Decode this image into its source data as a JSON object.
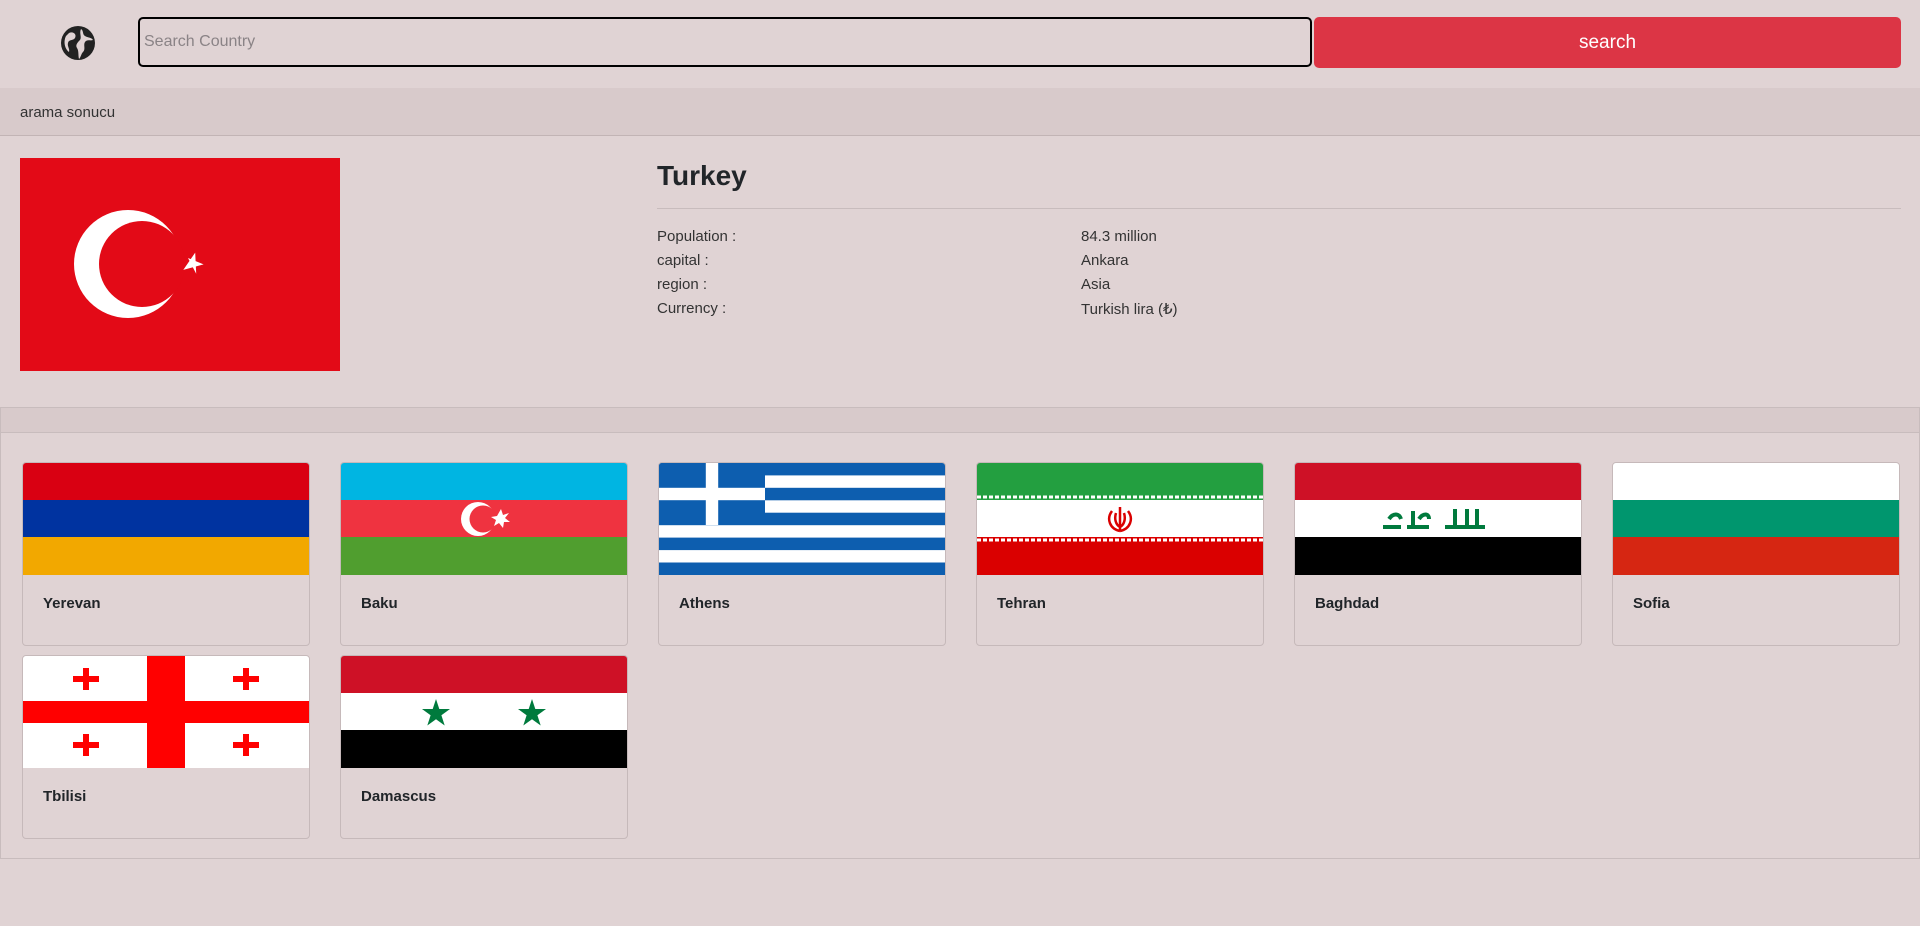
{
  "search": {
    "placeholder": "Search Country",
    "value": "",
    "button_label": "search"
  },
  "result_header": "arama sonucu",
  "country": {
    "name": "Turkey",
    "flag": "turkey-flag",
    "details": [
      {
        "label": "Population :",
        "value": "84.3 million"
      },
      {
        "label": "capital :",
        "value": "Ankara"
      },
      {
        "label": "region :",
        "value": "Asia"
      },
      {
        "label": "Currency :",
        "value": "Turkish lira (₺)"
      }
    ]
  },
  "neighbors": [
    {
      "capital": "Yerevan",
      "flag": "armenia-flag"
    },
    {
      "capital": "Baku",
      "flag": "azerbaijan-flag"
    },
    {
      "capital": "Athens",
      "flag": "greece-flag"
    },
    {
      "capital": "Tehran",
      "flag": "iran-flag"
    },
    {
      "capital": "Baghdad",
      "flag": "iraq-flag"
    },
    {
      "capital": "Sofia",
      "flag": "bulgaria-flag"
    },
    {
      "capital": "Tbilisi",
      "flag": "georgia-flag"
    },
    {
      "capital": "Damascus",
      "flag": "syria-flag"
    }
  ],
  "colors": {
    "background": "#e0d3d4",
    "header_band": "#d8cacb",
    "search_button": "#dc3545",
    "turkey_red": "#e30a17"
  }
}
